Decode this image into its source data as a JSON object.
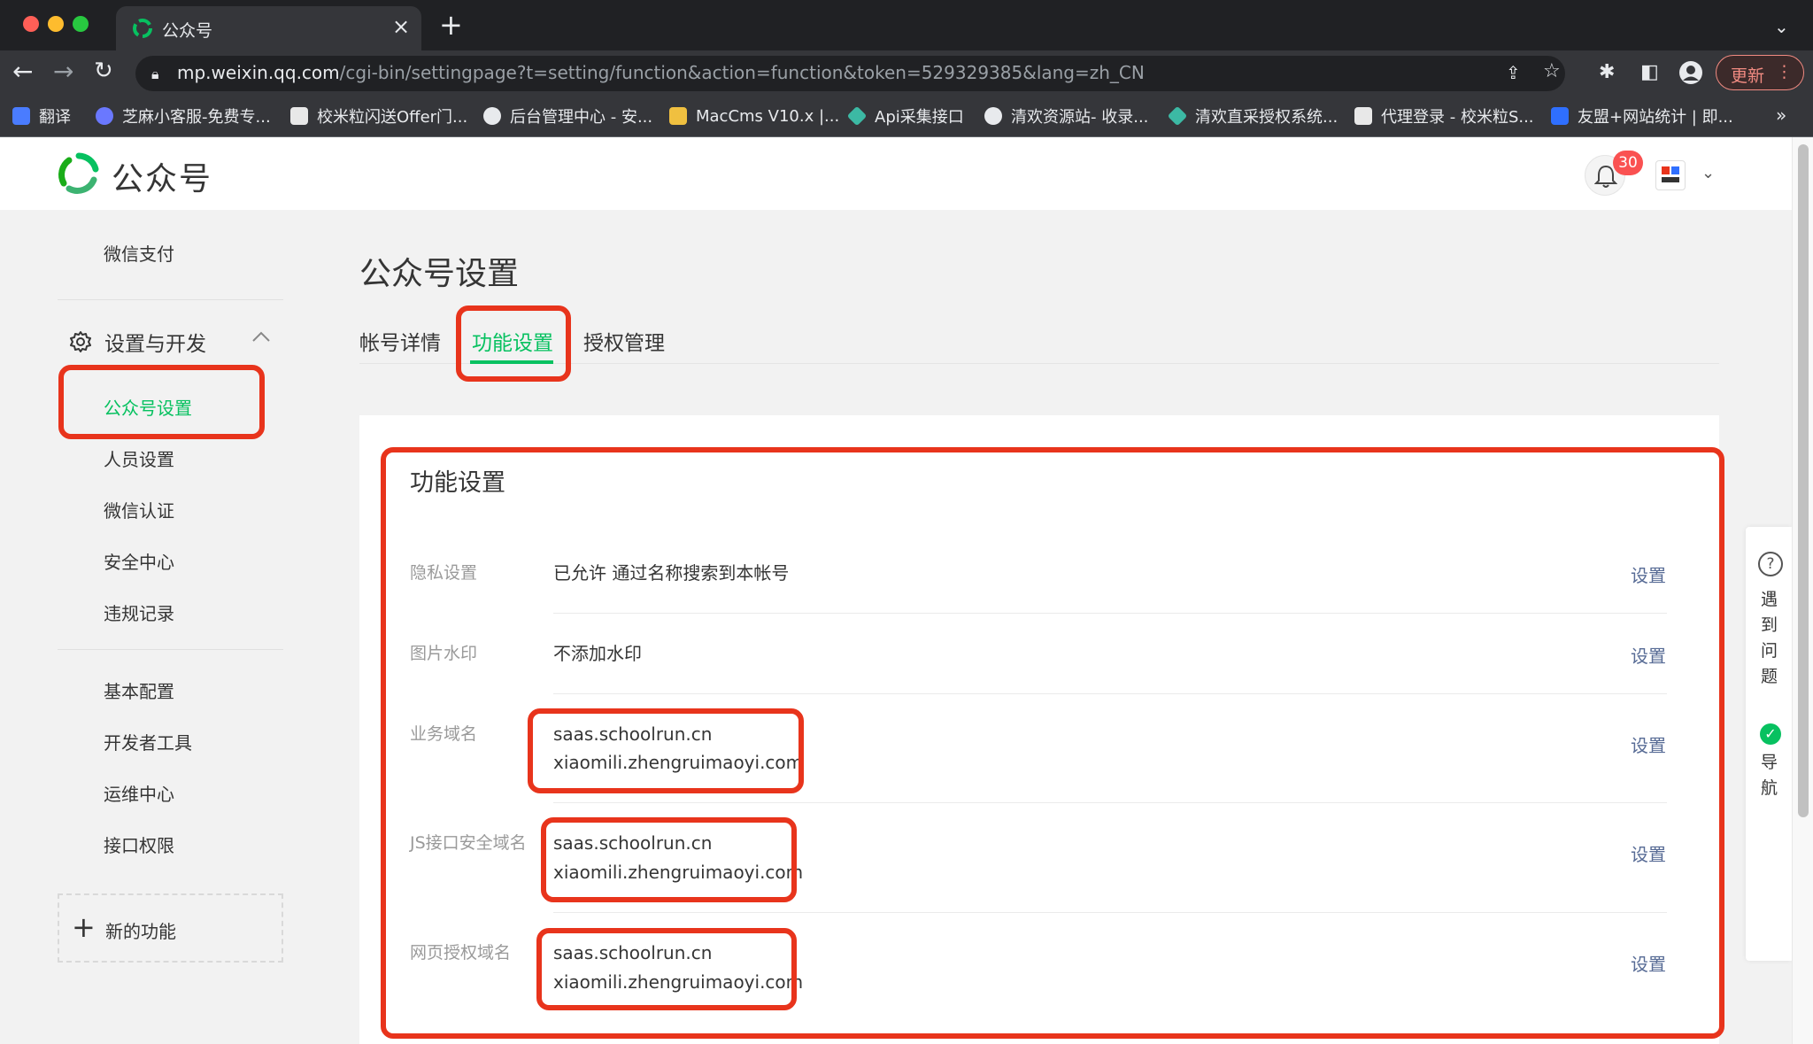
{
  "browser": {
    "tab_title": "公众号",
    "url_host": "mp.weixin.qq.com",
    "url_path": "/cgi-bin/settingpage?t=setting/function&action=function&token=529329385&lang=zh_CN",
    "update_label": "更新",
    "bookmarks": [
      {
        "label": "翻译",
        "color": "#4a7cff"
      },
      {
        "label": "芝麻小客服-免费专...",
        "color": "#6a78ff"
      },
      {
        "label": "校米粒闪送Offer门...",
        "color": "#e8e8e8"
      },
      {
        "label": "后台管理中心 - 安...",
        "color": "#e8eaed"
      },
      {
        "label": "MacCms V10.x |...",
        "color": "#f0c040"
      },
      {
        "label": "Api采集接口",
        "color": "#3cb9a4"
      },
      {
        "label": "清欢资源站- 收录...",
        "color": "#e8eaed"
      },
      {
        "label": "清欢直采授权系统...",
        "color": "#3cb9a4"
      },
      {
        "label": "代理登录 - 校米粒S...",
        "color": "#e8e8e8"
      },
      {
        "label": "友盟+网站统计 | 即...",
        "color": "#2f6fff"
      }
    ]
  },
  "header": {
    "brand": "公众号",
    "notification_count": "30"
  },
  "sidebar": {
    "top_item": "微信支付",
    "group_label": "设置与开发",
    "items": [
      "公众号设置",
      "人员设置",
      "微信认证",
      "安全中心",
      "违规记录"
    ],
    "items2": [
      "基本配置",
      "开发者工具",
      "运维中心",
      "接口权限"
    ],
    "new_feature": "新的功能"
  },
  "main": {
    "title": "公众号设置",
    "tabs": [
      "帐号详情",
      "功能设置",
      "授权管理"
    ],
    "section_title": "功能设置",
    "action_label": "设置",
    "rows": [
      {
        "label": "隐私设置",
        "value": "已允许 通过名称搜索到本帐号"
      },
      {
        "label": "图片水印",
        "value": "不添加水印"
      },
      {
        "label": "业务域名",
        "value1": "saas.schoolrun.cn",
        "value2": "xiaomili.zhengruimaoyi.com"
      },
      {
        "label": "JS接口安全域名",
        "value1": "saas.schoolrun.cn",
        "value2": "xiaomili.zhengruimaoyi.com"
      },
      {
        "label": "网页授权域名",
        "value1": "saas.schoolrun.cn",
        "value2": "xiaomili.zhengruimaoyi.com"
      }
    ]
  },
  "help": {
    "problem_label": "遇到问题",
    "nav_label": "导航"
  },
  "colors": {
    "brand_green": "#07c160",
    "link_blue": "#576b95",
    "highlight_red": "#e8341c",
    "badge_red": "#fa5151"
  }
}
